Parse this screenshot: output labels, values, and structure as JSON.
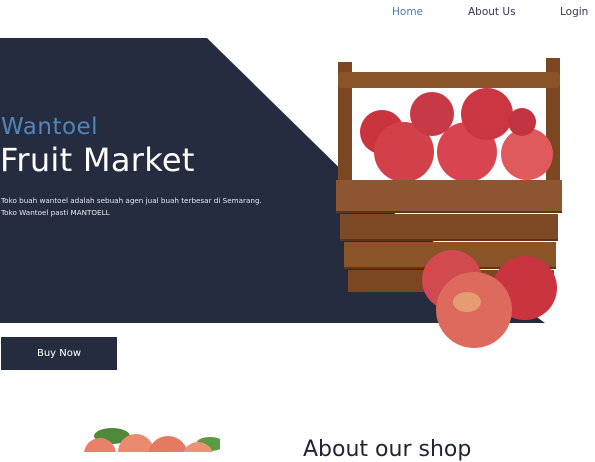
{
  "nav": {
    "items": [
      {
        "label": "Home",
        "active": true
      },
      {
        "label": "About Us",
        "active": false
      },
      {
        "label": "Login",
        "active": false
      }
    ]
  },
  "hero": {
    "brand": "Wantoel",
    "title": "Fruit Market",
    "description_line1": "Toko buah wantoel adalah sebuah agen jual buah terbesar di Semarang.",
    "description_line2": "Toko Wantoel pasti MANTOELL",
    "buy_button": "Buy Now"
  },
  "about": {
    "heading": "About our shop"
  },
  "colors": {
    "dark_navy": "#262c40",
    "accent_blue": "#4f86bd",
    "apple_red": "#c9343f",
    "crate_wood": "#8a5328"
  }
}
